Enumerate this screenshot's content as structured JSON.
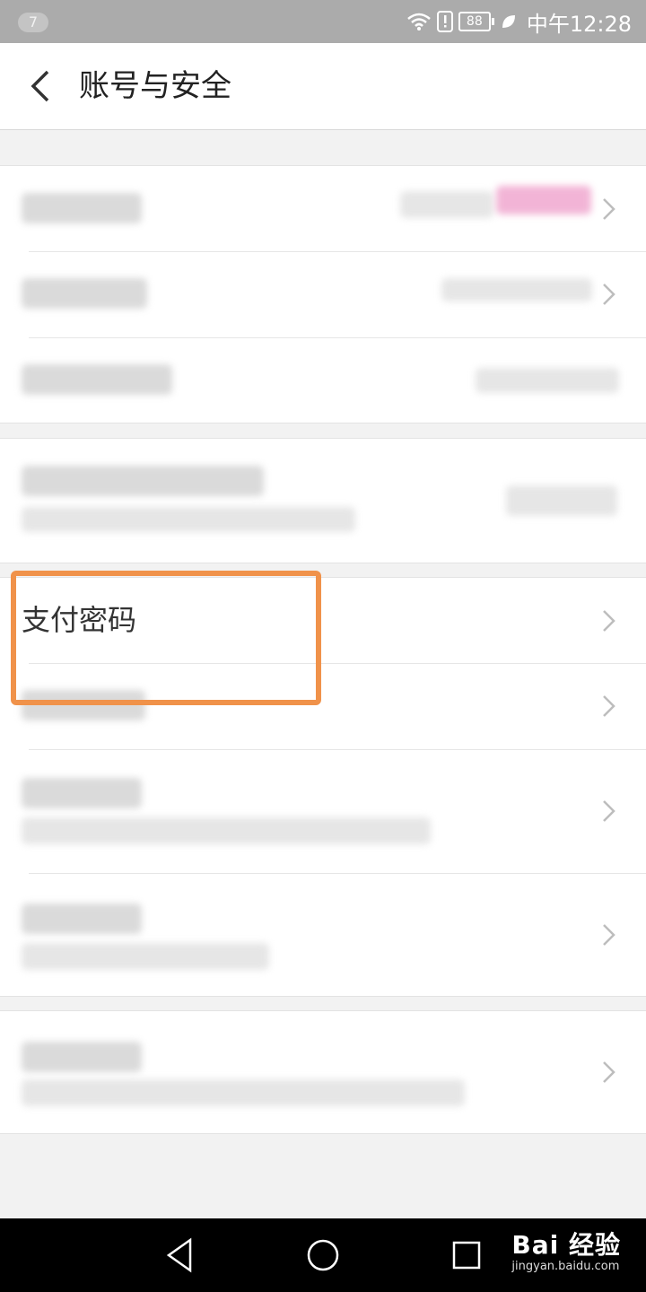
{
  "status_bar": {
    "notification_count": "7",
    "battery": "88",
    "time": "中午12:28",
    "icons": [
      "wifi-icon",
      "alert-icon",
      "battery-icon",
      "leaf-icon"
    ]
  },
  "header": {
    "back_icon": "chevron-left-icon",
    "title": "账号与安全"
  },
  "menu": {
    "payment_password": "支付密码"
  },
  "highlight": {
    "color": "#f0924a"
  },
  "nav_bar": {
    "back": "triangle-back-icon",
    "home": "circle-home-icon",
    "recents": "square-recents-icon"
  },
  "watermark": {
    "logo": "Bai 经验",
    "url": "jingyan.baidu.com"
  }
}
